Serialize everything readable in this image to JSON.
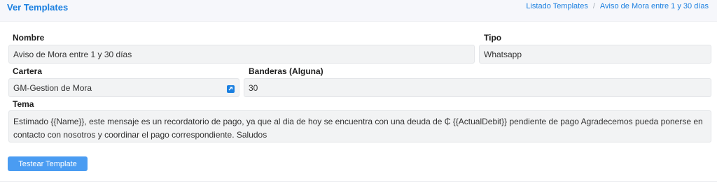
{
  "header": {
    "title": "Ver Templates",
    "breadcrumb": [
      "Listado Templates",
      "Aviso de Mora entre 1 y 30 días"
    ],
    "separator": "/"
  },
  "form": {
    "nombre": {
      "label": "Nombre",
      "value": "Aviso de Mora entre 1 y 30 días"
    },
    "tipo": {
      "label": "Tipo",
      "value": "Whatsapp"
    },
    "cartera": {
      "label": "Cartera",
      "value": "GM-Gestion de Mora"
    },
    "banderas": {
      "label": "Banderas (Alguna)",
      "value": "30"
    },
    "tema": {
      "label": "Tema",
      "value": "Estimado {{Name}}, este mensaje es un recordatorio de pago, ya que al dia de hoy se encuentra con una deuda de ₵ {{ActualDebit}} pendiente de pago Agradecemos pueda ponerse en contacto con nosotros y coordinar el pago correspondiente. Saludos"
    }
  },
  "actions": {
    "test_button": "Testear Template"
  },
  "colors": {
    "accent": "#1a7fe0",
    "button": "#4a9cf2",
    "field_bg": "#f2f3f4"
  }
}
